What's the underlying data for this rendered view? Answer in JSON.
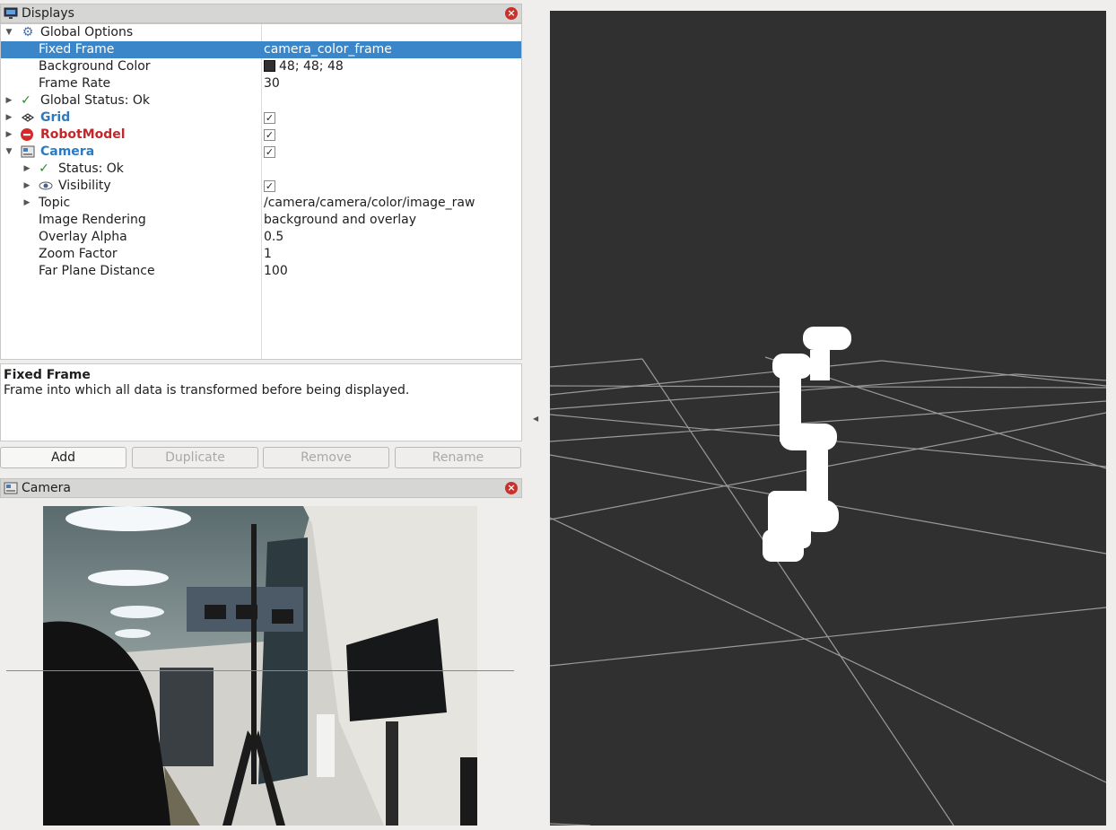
{
  "displays_panel": {
    "title": "Displays",
    "close_label": "×",
    "rows": [
      {
        "label": "Global Options"
      },
      {
        "label": "Fixed Frame",
        "value": "camera_color_frame"
      },
      {
        "label": "Background Color",
        "value": "48; 48; 48"
      },
      {
        "label": "Frame Rate",
        "value": "30"
      },
      {
        "label": "Global Status: Ok"
      },
      {
        "label": "Grid"
      },
      {
        "label": "RobotModel"
      },
      {
        "label": "Camera"
      },
      {
        "label": "Status: Ok"
      },
      {
        "label": "Visibility"
      },
      {
        "label": "Topic",
        "value": "/camera/camera/color/image_raw"
      },
      {
        "label": "Image Rendering",
        "value": "background and overlay"
      },
      {
        "label": "Overlay Alpha",
        "value": "0.5"
      },
      {
        "label": "Zoom Factor",
        "value": "1"
      },
      {
        "label": "Far Plane Distance",
        "value": "100"
      }
    ],
    "checkbox_mark": "✓"
  },
  "description": {
    "title": "Fixed Frame",
    "text": "Frame into which all data is transformed before being displayed."
  },
  "buttons": {
    "add": "Add",
    "duplicate": "Duplicate",
    "remove": "Remove",
    "rename": "Rename"
  },
  "camera_panel": {
    "title": "Camera",
    "close_label": "×"
  },
  "colors": {
    "selection": "#3a86c8",
    "viewport_bg": "#303030",
    "grid_line": "#a0a0a0",
    "robot": "#ffffff",
    "blue_label": "#2e7ac0",
    "red_label": "#c2282b"
  },
  "icons": {
    "displays": "monitor-icon",
    "global_options": "gear-icon",
    "global_status": "check-icon",
    "grid": "grid-icon",
    "robot_model": "error-icon",
    "camera": "camera-icon",
    "status": "check-icon",
    "visibility": "eye-icon"
  }
}
